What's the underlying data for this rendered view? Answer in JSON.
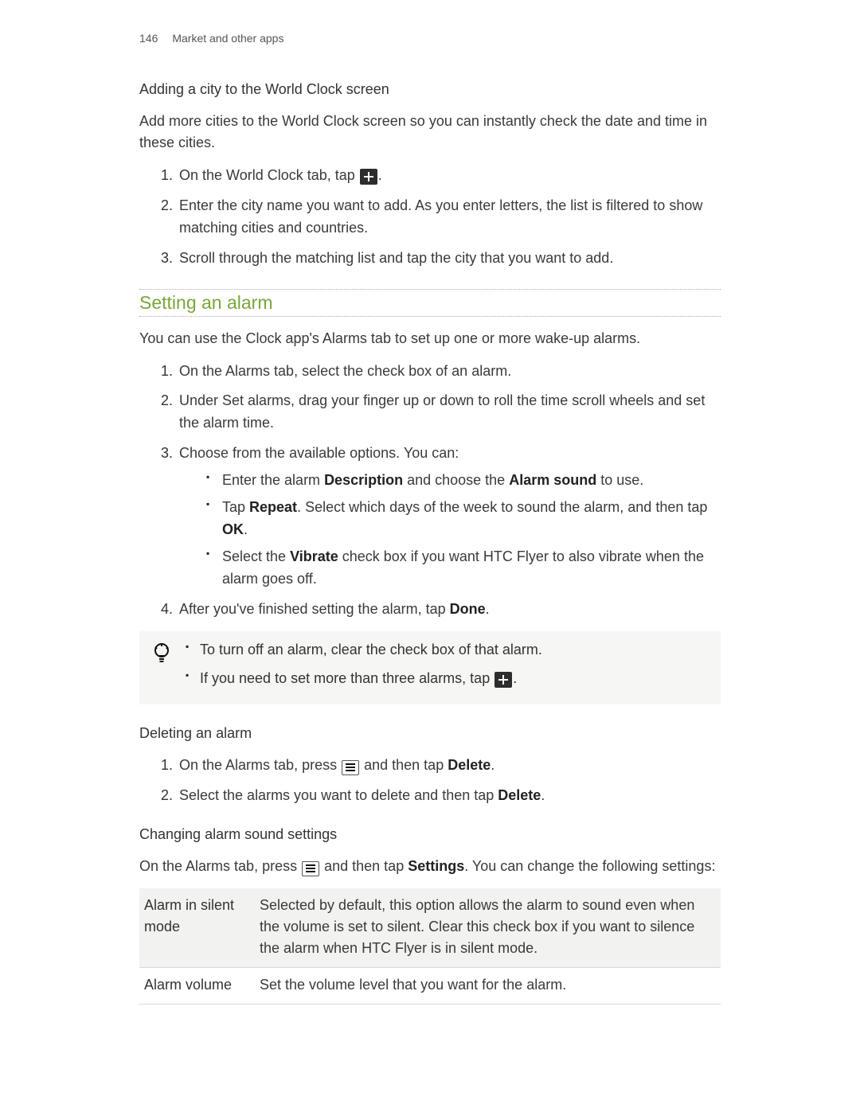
{
  "page": {
    "number": "146",
    "chapter": "Market and other apps"
  },
  "s1": {
    "title": "Adding a city to the World Clock screen",
    "intro": "Add more cities to the World Clock screen so you can instantly check the date and time in these cities.",
    "step1_pre": "On the World Clock tab, tap ",
    "step1_post": ".",
    "step2": "Enter the city name you want to add. As you enter letters, the list is filtered to show matching cities and countries.",
    "step3": "Scroll through the matching list and tap the city that you want to add."
  },
  "s2": {
    "heading": "Setting an alarm",
    "intro": "You can use the Clock app's Alarms tab to set up one or more wake-up alarms.",
    "step1": "On the Alarms tab, select the check box of an alarm.",
    "step2": "Under Set alarms, drag your finger up or down to roll the time scroll wheels and set the alarm time.",
    "step3": "Choose from the available options. You can:",
    "b1_pre": "Enter the alarm ",
    "b1_s1": "Description",
    "b1_mid": " and choose the ",
    "b1_s2": "Alarm sound",
    "b1_post": " to use.",
    "b2_pre": "Tap ",
    "b2_s1": "Repeat",
    "b2_mid": ". Select which days of the week to sound the alarm, and then tap ",
    "b2_s2": "OK",
    "b2_post": ".",
    "b3_pre": "Select the ",
    "b3_s1": "Vibrate",
    "b3_post": " check box if you want HTC Flyer to also vibrate when the alarm goes off.",
    "step4_pre": "After you've finished setting the alarm, tap ",
    "step4_s1": "Done",
    "step4_post": "."
  },
  "tip": {
    "t1": "To turn off an alarm, clear the check box of that alarm.",
    "t2_pre": "If you need to set more than three alarms, tap ",
    "t2_post": "."
  },
  "s3": {
    "title": "Deleting an alarm",
    "step1_pre": "On the Alarms tab, press ",
    "step1_mid": " and then tap ",
    "step1_s1": "Delete",
    "step1_post": ".",
    "step2_pre": "Select the alarms you want to delete and then tap ",
    "step2_s1": "Delete",
    "step2_post": "."
  },
  "s4": {
    "title": "Changing alarm sound settings",
    "intro_pre": "On the Alarms tab, press ",
    "intro_mid": " and then tap ",
    "intro_s1": "Settings",
    "intro_post": ". You can change the following settings:"
  },
  "table": {
    "r1k": "Alarm in silent mode",
    "r1v": "Selected by default, this option allows the alarm to sound even when the volume is set to silent. Clear this check box if you want to silence the alarm when HTC Flyer is in silent mode.",
    "r2k": "Alarm volume",
    "r2v": "Set the volume level that you want for the alarm."
  }
}
